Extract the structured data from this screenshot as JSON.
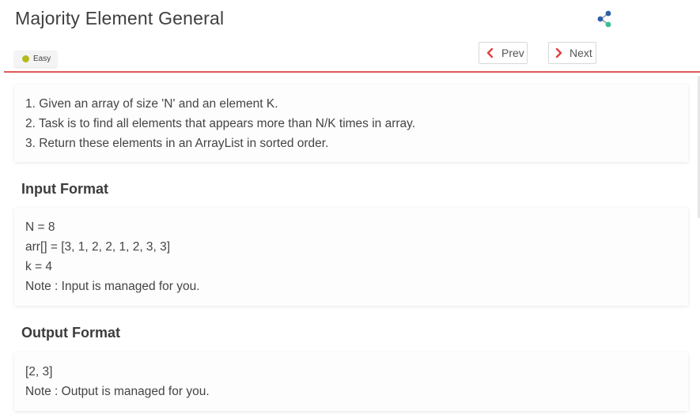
{
  "header": {
    "title": "Majority Element General",
    "difficulty": "Easy",
    "prev_label": "Prev",
    "next_label": "Next",
    "share_icon": "share-icon",
    "accent_color": "#e05a5a",
    "difficulty_color": "#b3ba1e"
  },
  "description": {
    "lines": [
      "1. Given an array of size 'N' and an element K.",
      "2. Task is to find all elements that appears more than N/K times in array.",
      "3. Return these elements in an ArrayList in sorted order."
    ]
  },
  "input_format": {
    "heading": "Input Format",
    "lines": [
      "N = 8",
      "arr[] = [3, 1, 2, 2, 1, 2, 3, 3]",
      "k = 4",
      "Note : Input is managed for you."
    ]
  },
  "output_format": {
    "heading": "Output Format",
    "lines": [
      "[2, 3]",
      "Note : Output is managed for you."
    ]
  }
}
